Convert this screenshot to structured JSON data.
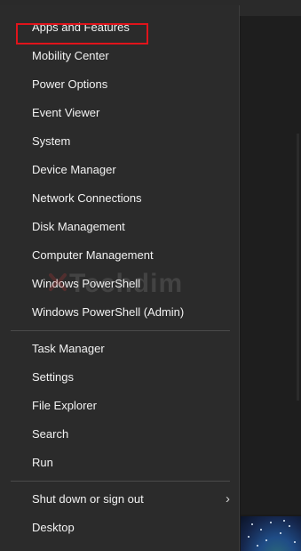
{
  "menu": {
    "items": [
      {
        "label": "Apps and Features"
      },
      {
        "label": "Mobility Center"
      },
      {
        "label": "Power Options"
      },
      {
        "label": "Event Viewer"
      },
      {
        "label": "System"
      },
      {
        "label": "Device Manager"
      },
      {
        "label": "Network Connections"
      },
      {
        "label": "Disk Management"
      },
      {
        "label": "Computer Management"
      },
      {
        "label": "Windows PowerShell"
      },
      {
        "label": "Windows PowerShell (Admin)"
      },
      {
        "label": "Task Manager"
      },
      {
        "label": "Settings"
      },
      {
        "label": "File Explorer"
      },
      {
        "label": "Search"
      },
      {
        "label": "Run"
      },
      {
        "label": "Shut down or sign out",
        "has_submenu": true,
        "submenu_icon": "chevron-right-icon"
      },
      {
        "label": "Desktop"
      }
    ],
    "highlighted_item": "Apps and Features"
  },
  "watermark": {
    "text": "Techdim"
  },
  "colors": {
    "menu_background": "#2b2b2b",
    "menu_text": "#f2f2f2",
    "highlight_border": "#e0141b",
    "separator": "#4a4a4a"
  }
}
